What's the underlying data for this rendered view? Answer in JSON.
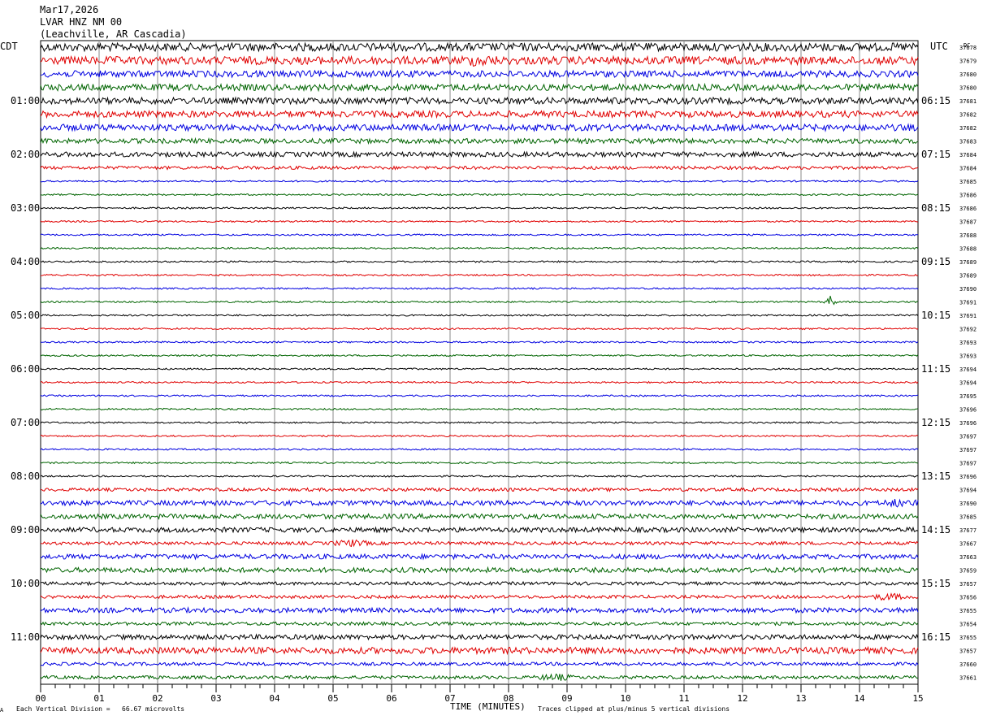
{
  "header": {
    "date": "Mar17,2026",
    "station": "LVAR HNZ NM 00",
    "location": "(Leachville, AR Cascadia)"
  },
  "labels": {
    "left_tz": "CDT",
    "right_tz": "UTC",
    "dc_label": "DC"
  },
  "footer": {
    "vertical_division": "Each Vertical Division =   66.67 microvolts",
    "x_title": "TIME (MINUTES)",
    "clip_note": "Traces clipped at plus/minus 5 vertical divisions",
    "corner_mark": "A"
  },
  "chart_data": {
    "type": "line",
    "title": "LVAR HNZ NM 00",
    "xlabel": "TIME (MINUTES)",
    "xlim": [
      0,
      15
    ],
    "x_ticks": [
      "00",
      "01",
      "02",
      "03",
      "04",
      "05",
      "06",
      "07",
      "08",
      "09",
      "10",
      "11",
      "12",
      "13",
      "14",
      "15"
    ],
    "left_hour_labels": [
      "01:00",
      "02:00",
      "03:00",
      "04:00",
      "05:00",
      "06:00",
      "07:00",
      "08:00",
      "09:00",
      "10:00",
      "11:00"
    ],
    "right_hour_labels": [
      "06:15",
      "07:15",
      "08:15",
      "09:15",
      "10:15",
      "11:15",
      "12:15",
      "13:15",
      "14:15",
      "15:15",
      "16:15"
    ],
    "trace_colors": [
      "#000000",
      "#e00000",
      "#0000e0",
      "#006400"
    ],
    "dc_offsets": [
      37678,
      37679,
      37680,
      37680,
      37681,
      37682,
      37682,
      37683,
      37684,
      37684,
      37685,
      37686,
      37686,
      37687,
      37688,
      37688,
      37689,
      37689,
      37690,
      37691,
      37691,
      37692,
      37693,
      37693,
      37694,
      37694,
      37695,
      37696,
      37696,
      37697,
      37697,
      37697,
      37696,
      37694,
      37690,
      37685,
      37677,
      37667,
      37663,
      37659,
      37657,
      37656,
      37655,
      37654,
      37655,
      37657,
      37660,
      37661
    ],
    "amplitudes": [
      5,
      5,
      4,
      4,
      4,
      4,
      4,
      3,
      3,
      2,
      1,
      1,
      1,
      1,
      1,
      1,
      1,
      1,
      1,
      1,
      1,
      1,
      1,
      1,
      1,
      1,
      1,
      1,
      1,
      1,
      1,
      1,
      1,
      2,
      3,
      3,
      3,
      2,
      3,
      3,
      2,
      2,
      3,
      2,
      3,
      4,
      2,
      2
    ],
    "events": [
      {
        "trace": 1,
        "minute": 7.5,
        "label": "burst"
      },
      {
        "trace": 19,
        "minute": 13.5,
        "label": "spike"
      },
      {
        "trace": 34,
        "minute": 14.7,
        "label": "burst"
      },
      {
        "trace": 37,
        "minute": 5.3,
        "label": "burst"
      },
      {
        "trace": 41,
        "minute": 14.5,
        "label": "burst"
      },
      {
        "trace": 47,
        "minute": 8.8,
        "label": "burst"
      }
    ]
  }
}
